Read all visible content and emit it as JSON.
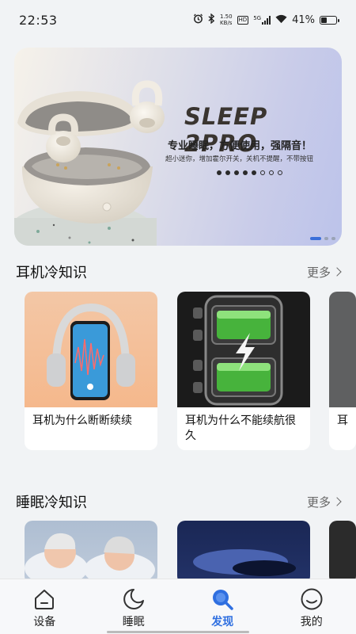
{
  "status_bar": {
    "time": "22:53",
    "net_speed_value": "1.50",
    "net_speed_unit": "KB/s",
    "hd": "HD",
    "network": "5G",
    "battery": "41%"
  },
  "banner": {
    "title": "SLEEP 2PRO",
    "subtitle": "专业睡眠，方便使用，强隔音！",
    "description": "超小迷你，增加霍尔开关，关机不提醒，不带按钮",
    "dots_filled": 5,
    "dots_hollow": 3
  },
  "sections": [
    {
      "title": "耳机冷知识",
      "more": "更多",
      "cards": [
        {
          "text": "耳机为什么断断续续"
        },
        {
          "text": "耳机为什么不能续航很久"
        },
        {
          "text": "耳"
        }
      ]
    },
    {
      "title": "睡眠冷知识",
      "more": "更多",
      "cards": [
        {
          "text": ""
        },
        {
          "text": ""
        }
      ]
    }
  ],
  "nav": [
    {
      "label": "设备",
      "icon": "device-icon"
    },
    {
      "label": "睡眠",
      "icon": "moon-icon"
    },
    {
      "label": "发现",
      "icon": "search-icon",
      "active": true
    },
    {
      "label": "我的",
      "icon": "profile-icon"
    }
  ],
  "colors": {
    "accent": "#2f6fe0"
  }
}
